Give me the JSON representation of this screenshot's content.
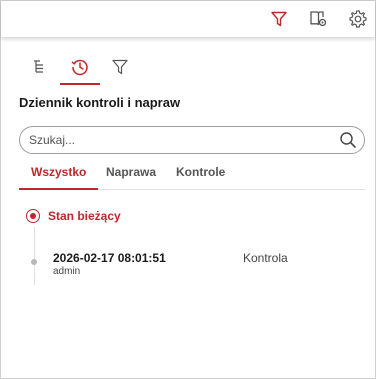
{
  "toolbar": {
    "filter_icon": "filter-icon",
    "book_icon": "book-settings-icon",
    "settings_icon": "gear-icon",
    "accent_color": "#c0272d"
  },
  "panel": {
    "icon_tabs": [
      {
        "name": "tree-icon",
        "active": false
      },
      {
        "name": "history-icon",
        "active": true
      },
      {
        "name": "filter-icon",
        "active": false
      }
    ],
    "title": "Dziennik kontroli i napraw",
    "search": {
      "placeholder": "Szukaj...",
      "value": ""
    },
    "tabs": [
      {
        "label": "Wszystko",
        "active": true
      },
      {
        "label": "Naprawa",
        "active": false
      },
      {
        "label": "Kontrole",
        "active": false
      }
    ],
    "current_state_label": "Stan bieżący",
    "entries": [
      {
        "date": "2026-02-17 08:01:51",
        "user": "admin",
        "type": "Kontrola"
      }
    ]
  }
}
